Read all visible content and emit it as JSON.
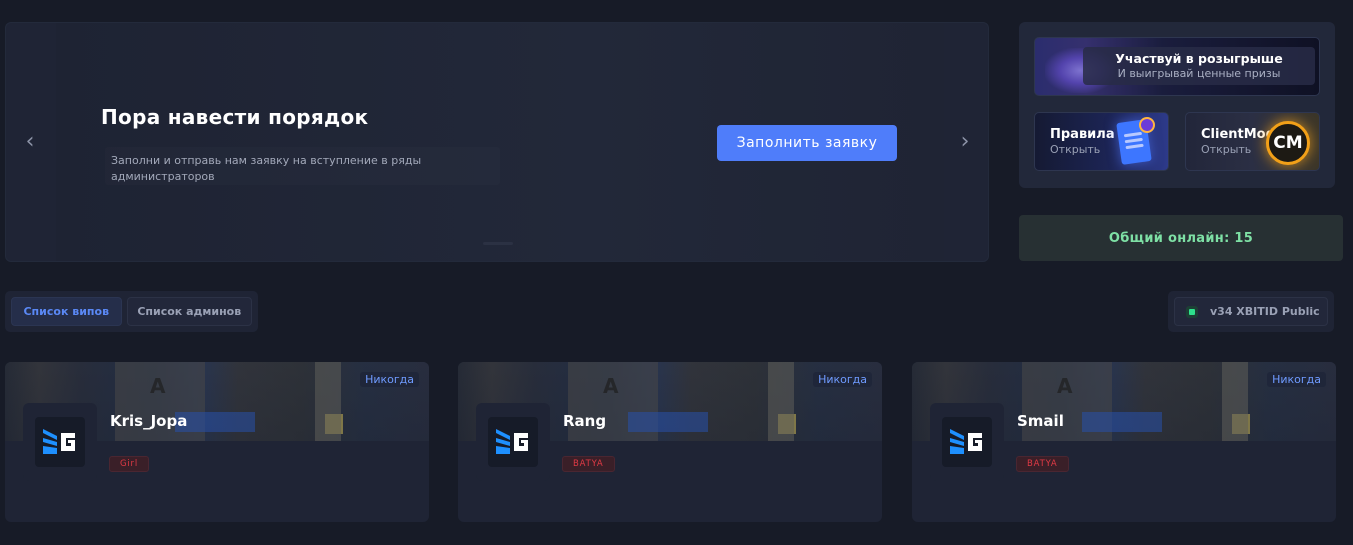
{
  "hero": {
    "title": "Пора навести порядок",
    "description": "Заполни и отправь нам заявку на вступление в ряды администраторов",
    "button_label": "Заполнить заявку",
    "prev_arrow": "‹",
    "next_arrow": "›"
  },
  "promo": {
    "giveaway": {
      "title": "Участвуй в розыгрыше",
      "subtitle": "И выигрывай ценные призы"
    },
    "rules": {
      "title": "Правила",
      "subtitle": "Открыть"
    },
    "client": {
      "title": "ClientMod",
      "subtitle": "Открыть",
      "logo_text": "CM"
    }
  },
  "online": {
    "label": "Общий онлайн: 15"
  },
  "tabs": [
    {
      "label": "Список випов",
      "active": true
    },
    {
      "label": "Список админов",
      "active": false
    }
  ],
  "server": {
    "label": "v34 XBITID Public",
    "status_color": "#2ee08c"
  },
  "players": [
    {
      "name": "Kris_Jopa",
      "group": "Girl",
      "expires": "Никогда"
    },
    {
      "name": "Rang",
      "group": "BATYA",
      "expires": "Никогда"
    },
    {
      "name": "Smail",
      "group": "BATYA",
      "expires": "Никогда"
    }
  ],
  "colors": {
    "accent": "#4f7dfa",
    "background": "#171b27",
    "online_text": "#7ee0a5",
    "group_badge": "#e03a45"
  }
}
